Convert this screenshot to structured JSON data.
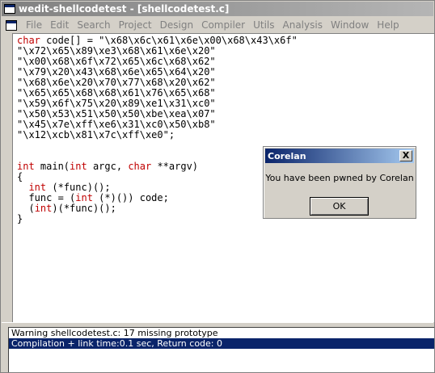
{
  "window": {
    "title": "wedit-shellcodetest - [shellcodetest.c]"
  },
  "menu": {
    "items": [
      "File",
      "Edit",
      "Search",
      "Project",
      "Design",
      "Compiler",
      "Utils",
      "Analysis",
      "Window",
      "Help"
    ]
  },
  "editor": {
    "lines": [
      [
        {
          "t": "char",
          "k": true
        },
        {
          "t": " code[] = \"\\x68\\x6c\\x61\\x6e\\x00\\x68\\x43\\x6f\"",
          "k": false
        }
      ],
      [
        {
          "t": "\"\\x72\\x65\\x89\\xe3\\x68\\x61\\x6e\\x20\"",
          "k": false
        }
      ],
      [
        {
          "t": "\"\\x00\\x68\\x6f\\x72\\x65\\x6c\\x68\\x62\"",
          "k": false
        }
      ],
      [
        {
          "t": "\"\\x79\\x20\\x43\\x68\\x6e\\x65\\x64\\x20\"",
          "k": false
        }
      ],
      [
        {
          "t": "\"\\x68\\x6e\\x20\\x70\\x77\\x68\\x20\\x62\"",
          "k": false
        }
      ],
      [
        {
          "t": "\"\\x65\\x65\\x68\\x68\\x61\\x76\\x65\\x68\"",
          "k": false
        }
      ],
      [
        {
          "t": "\"\\x59\\x6f\\x75\\x20\\x89\\xe1\\x31\\xc0\"",
          "k": false
        }
      ],
      [
        {
          "t": "\"\\x50\\x53\\x51\\x50\\x50\\xbe\\xea\\x07\"",
          "k": false
        }
      ],
      [
        {
          "t": "\"\\x45\\x7e\\xff\\xe6\\x31\\xc0\\x50\\xb8\"",
          "k": false
        }
      ],
      [
        {
          "t": "\"\\x12\\xcb\\x81\\x7c\\xff\\xe0\";",
          "k": false
        }
      ],
      [],
      [],
      [
        {
          "t": "int",
          "k": true
        },
        {
          "t": " main(",
          "k": false
        },
        {
          "t": "int",
          "k": true
        },
        {
          "t": " argc, ",
          "k": false
        },
        {
          "t": "char",
          "k": true
        },
        {
          "t": " **argv)",
          "k": false
        }
      ],
      [
        {
          "t": "{",
          "k": false
        }
      ],
      [
        {
          "t": "  ",
          "k": false
        },
        {
          "t": "int",
          "k": true
        },
        {
          "t": " (*func)();",
          "k": false
        }
      ],
      [
        {
          "t": "  func = (",
          "k": false
        },
        {
          "t": "int",
          "k": true
        },
        {
          "t": " (*)()) code;",
          "k": false
        }
      ],
      [
        {
          "t": "  (",
          "k": false
        },
        {
          "t": "int",
          "k": true
        },
        {
          "t": ")(*func)();",
          "k": false
        }
      ],
      [
        {
          "t": "}",
          "k": false
        }
      ]
    ]
  },
  "output": {
    "lines": [
      "Warning shellcodetest.c: 17  missing prototype",
      "Compilation + link time:0.1 sec, Return code: 0"
    ]
  },
  "dialog": {
    "title": "Corelan",
    "close_label": "X",
    "message": "You have been pwned by Corelan",
    "ok_label": "OK"
  }
}
